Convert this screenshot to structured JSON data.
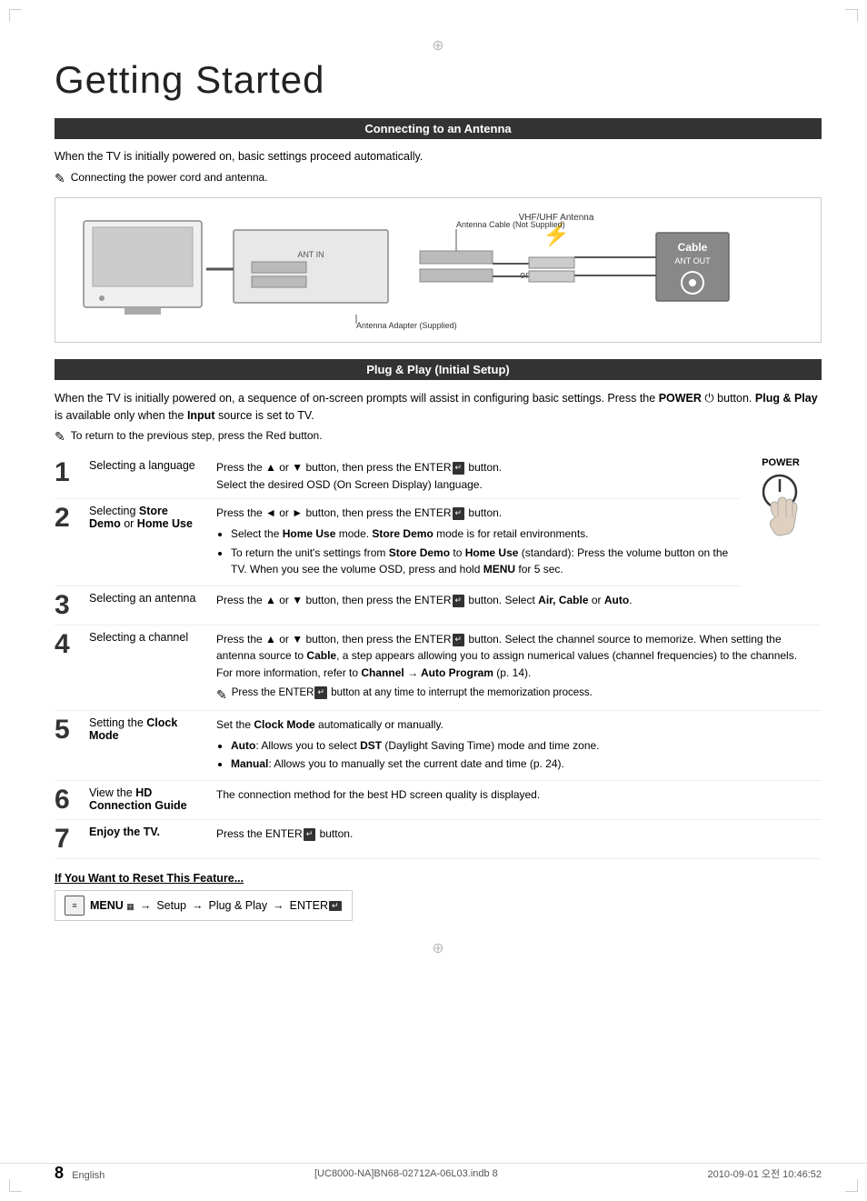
{
  "page": {
    "title": "Getting Started",
    "page_number": "8",
    "language": "English",
    "file_info": "[UC8000-NA]BN68-02712A-06L03.indb   8",
    "date_info": "2010-09-01   오전 10:46:52"
  },
  "section1": {
    "header": "Connecting to an Antenna",
    "para1": "When the TV is initially powered on, basic settings proceed automatically.",
    "note1": "Connecting the power cord and antenna.",
    "diagram": {
      "vhf_label": "VHF/UHF Antenna",
      "cable_label": "Antenna Cable (Not Supplied)",
      "adapter_label": "Antenna Adapter (Supplied)",
      "cable_box_label": "Cable",
      "cable_box_sub": "ANT OUT",
      "or_text": "or"
    }
  },
  "section2": {
    "header": "Plug & Play (Initial Setup)",
    "para1": "When the TV is initially powered on, a sequence of on-screen prompts will assist in configuring basic settings. Press the POWER",
    "para1b": " button. ",
    "para1c": "Plug & Play",
    "para1d": " is available only when the ",
    "para1e": "Input",
    "para1f": " source is set to TV.",
    "note1": "To return to the previous step, press the Red button.",
    "power_label": "POWER",
    "steps": [
      {
        "num": "1",
        "title": "Selecting a language",
        "desc": "Press the ▲ or ▼ button, then press the ENTER",
        "desc2": " button.\nSelect the desired OSD (On Screen Display) language.",
        "bullets": []
      },
      {
        "num": "2",
        "title_pre": "Selecting ",
        "title_bold": "Store Demo",
        "title_mid": " or ",
        "title_bold2": "Home Use",
        "desc": "Press the ◄ or ► button, then press the ENTER",
        "desc2": " button.",
        "bullets": [
          "Select the Home Use mode. Store Demo mode is for retail environments.",
          "To return the unit's settings from Store Demo to Home Use (standard): Press the volume button on the TV. When you see the volume OSD, press and hold MENU for 5 sec."
        ]
      },
      {
        "num": "3",
        "title": "Selecting an antenna",
        "desc": "Press the ▲ or ▼ button, then press the ENTER",
        "desc2": " button. Select Air, Cable or Auto.",
        "bullets": []
      },
      {
        "num": "4",
        "title": "Selecting a channel",
        "desc": "Press the ▲ or ▼ button, then press the ENTER",
        "desc2": " button. Select the channel source to memorize. When setting the antenna source to Cable, a step appears allowing you to assign numerical values (channel frequencies) to the channels. For more information, refer to Channel → Auto Program (p. 14).",
        "note": "Press the ENTER",
        "note2": " button at any time to interrupt the memorization process.",
        "bullets": []
      },
      {
        "num": "5",
        "title_pre": "Setting the ",
        "title_bold": "Clock",
        "title_mid": "\nMode",
        "desc": "Set the Clock Mode automatically or manually.",
        "bullets": [
          "Auto: Allows you to select DST (Daylight Saving Time) mode and time zone.",
          "Manual: Allows you to manually set the current date and time (p. 24)."
        ]
      },
      {
        "num": "6",
        "title_pre": "View the ",
        "title_bold": "HD\nConnection Guide",
        "desc": "The connection method for the best HD screen quality is displayed.",
        "bullets": []
      },
      {
        "num": "7",
        "title_pre": "Enjoy the TV.",
        "desc": "Press the ENTER",
        "desc2": " button.",
        "bullets": []
      }
    ]
  },
  "reset": {
    "title": "If You Want to Reset This Feature...",
    "line": "MENU",
    "arrow1": "→",
    "setup": "Setup",
    "arrow2": "→",
    "plug": "Plug & Play",
    "arrow3": "→",
    "enter": "ENTER"
  }
}
